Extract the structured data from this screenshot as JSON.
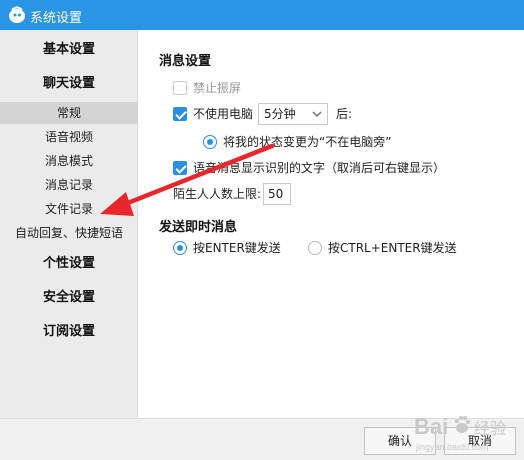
{
  "window": {
    "title": "系统设置"
  },
  "sidebar": {
    "categories": {
      "basic": "基本设置",
      "chat": "聊天设置",
      "personal": "个性设置",
      "security": "安全设置",
      "subscription": "订阅设置"
    },
    "chat_items": [
      "常规",
      "语音视频",
      "消息模式",
      "消息记录",
      "文件记录",
      "自动回复、快捷短语"
    ],
    "active_item": "常规"
  },
  "main": {
    "message_settings": {
      "title": "消息设置",
      "disable_shake": {
        "label": "禁止振屏",
        "checked": false
      },
      "away": {
        "label": "不使用电脑",
        "checked": true,
        "duration": "5分钟",
        "suffix": "后:"
      },
      "away_status": {
        "label": "将我的状态变更为“不在电脑旁”",
        "selected": true
      },
      "voice_text": {
        "label": "语音消息显示识别的文字（取消后可右键显示）",
        "checked": true
      },
      "stranger_limit": {
        "label": "陌生人人数上限:",
        "value": "50"
      }
    },
    "send_settings": {
      "title": "发送即时消息",
      "option_enter": {
        "label": "按ENTER键发送",
        "selected": true
      },
      "option_ctrl_enter": {
        "label": "按CTRL+ENTER键发送",
        "selected": false
      }
    }
  },
  "footer": {
    "ok": "确认",
    "cancel": "取消"
  },
  "watermark": {
    "brand": "Bai",
    "brand_suffix": "经验",
    "domain": "jingyan.baidu.com"
  },
  "colors": {
    "titlebar": "#2a95e4",
    "accent": "#2a8fe0",
    "annotation_arrow": "#e8262b"
  }
}
